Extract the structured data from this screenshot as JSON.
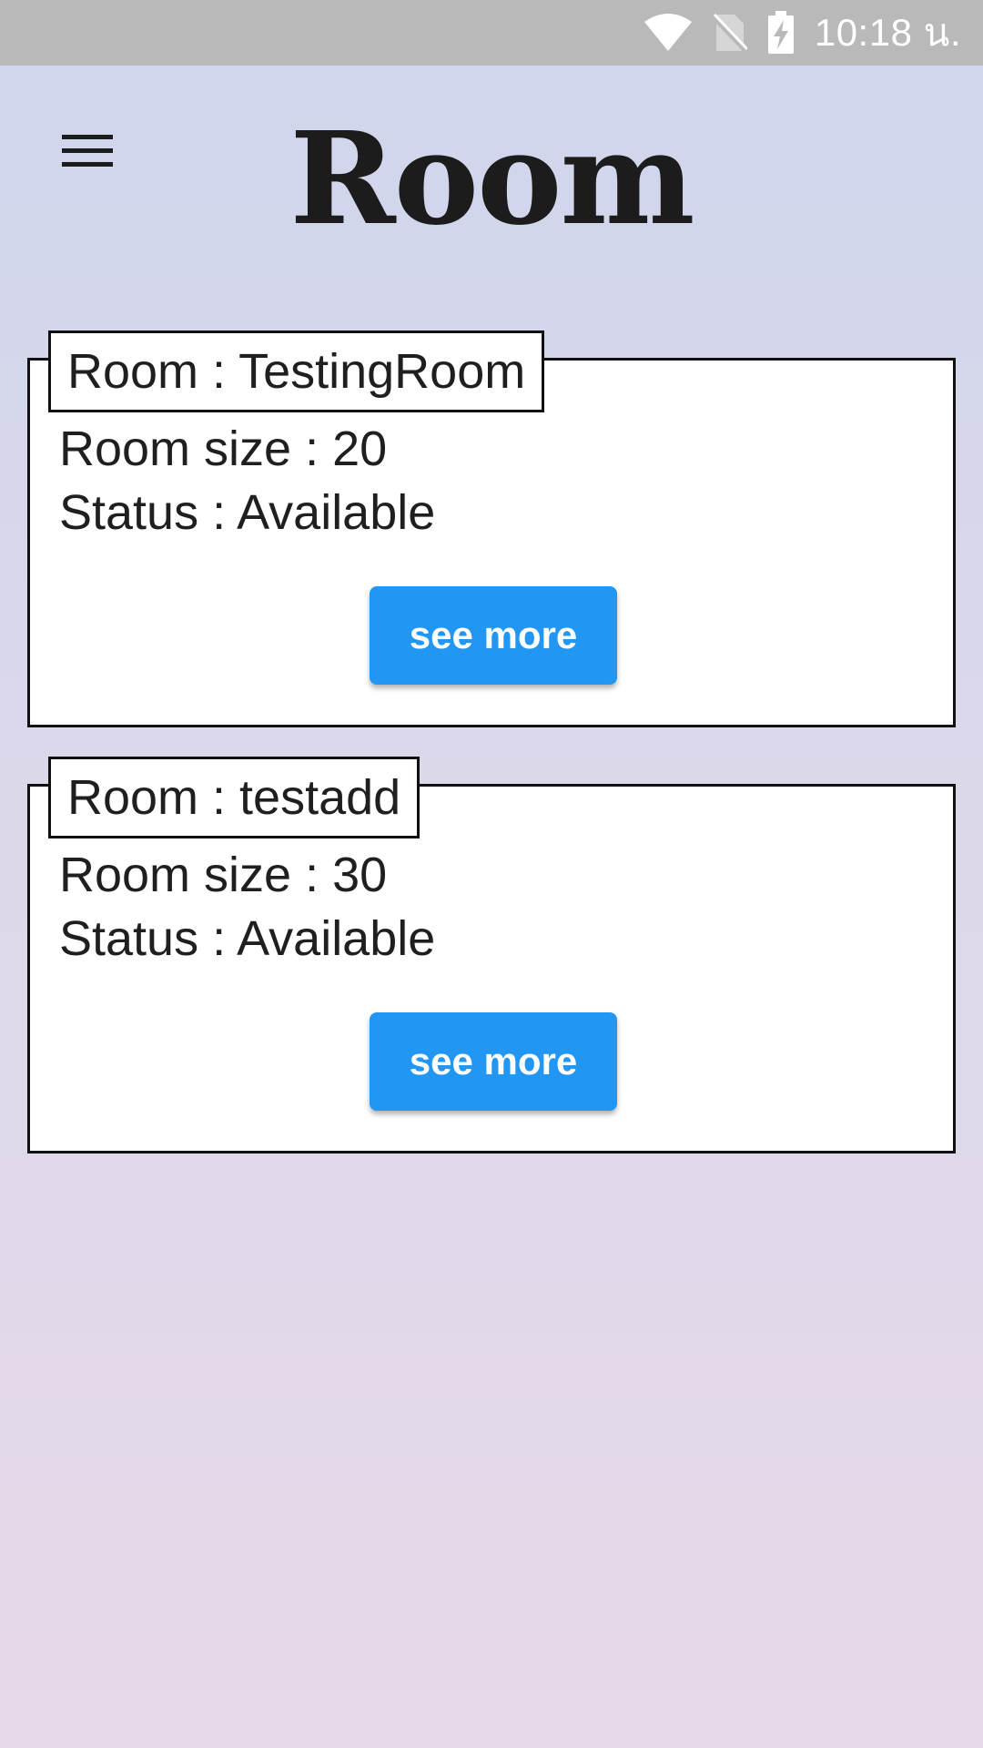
{
  "status_bar": {
    "time": "10:18 น.",
    "icons": [
      "wifi-icon",
      "no-sim-icon",
      "battery-charging-icon"
    ]
  },
  "app_bar": {
    "menu_icon": "hamburger-menu-icon",
    "title": "Room"
  },
  "rooms": [
    {
      "name": "Room : TestingRoom",
      "size": "Room size : 20",
      "status": "Status : Available",
      "button_label": "see more"
    },
    {
      "name": "Room : testadd",
      "size": "Room size : 30",
      "status": "Status : Available",
      "button_label": "see more"
    }
  ],
  "colors": {
    "accent": "#2196f3",
    "status_bar": "#b9b9b9"
  }
}
